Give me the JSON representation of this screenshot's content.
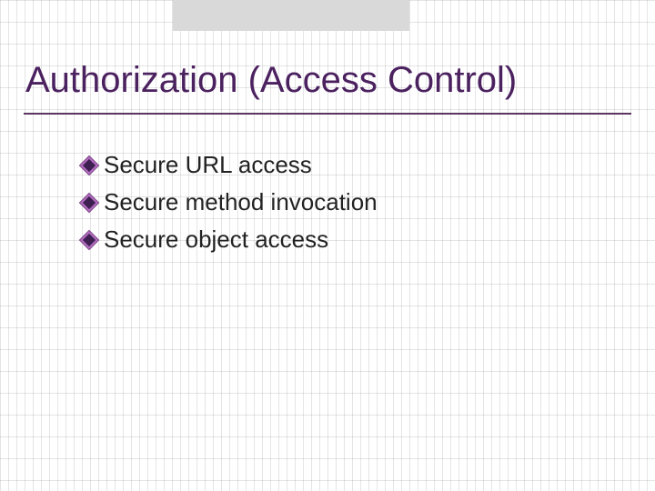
{
  "slide": {
    "title": "Authorization (Access Control)",
    "bullets": [
      {
        "text": "Secure URL access"
      },
      {
        "text": "Secure method invocation"
      },
      {
        "text": "Secure object access"
      }
    ]
  },
  "theme": {
    "title_color": "#4b215f",
    "bullet_outer": "#b36cc0",
    "bullet_inner": "#3e1f52"
  }
}
